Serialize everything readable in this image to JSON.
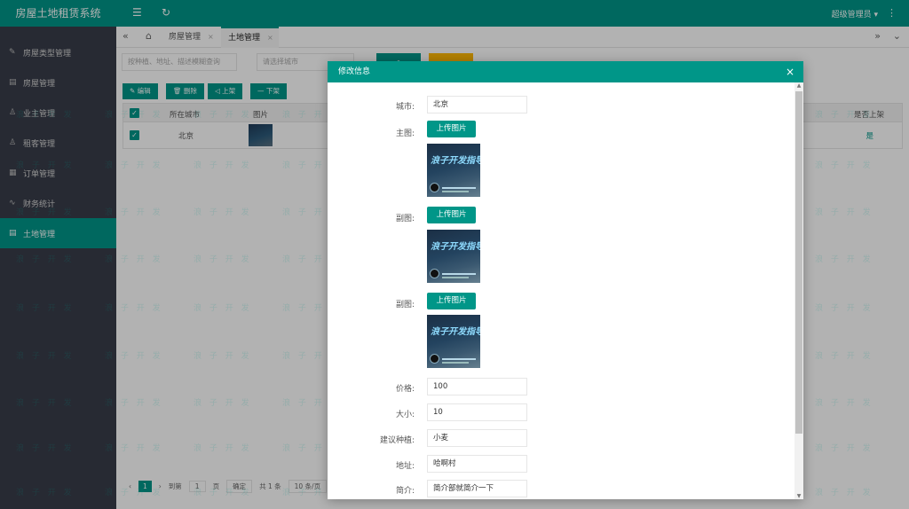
{
  "app": {
    "title": "房屋土地租赁系统"
  },
  "sidebar": {
    "items": [
      {
        "label": "房屋类型管理",
        "icon": "✎"
      },
      {
        "label": "房屋管理",
        "icon": "▤"
      },
      {
        "label": "业主管理",
        "icon": "♙"
      },
      {
        "label": "租客管理",
        "icon": "♙"
      },
      {
        "label": "订单管理",
        "icon": "▦"
      },
      {
        "label": "财务统计",
        "icon": "∿"
      },
      {
        "label": "土地管理",
        "icon": "▤"
      }
    ],
    "active": "土地管理"
  },
  "header": {
    "menu_icon": "☰",
    "refresh_icon": "↻",
    "user": "超级管理员 ▾",
    "more_icon": "⋮"
  },
  "tabs": {
    "prev_icon": "«",
    "home_icon": "⌂",
    "next_icon": "»",
    "dropdown_icon": "⌄",
    "items": [
      {
        "label": "房屋管理",
        "close": "×"
      },
      {
        "label": "土地管理",
        "close": "×"
      }
    ]
  },
  "background": {
    "search_placeholder": "按种植、地址、描述模糊查询",
    "city_placeholder": "请选择城市",
    "toolbar": {
      "edit": "✎ 编辑",
      "delete": "🗑 删除",
      "up": "◁ 上架",
      "down": "— 下架"
    },
    "columns": {
      "check": "✓",
      "city": "所在城市",
      "image": "图片",
      "listed": "是否上架"
    },
    "row": {
      "city": "北京",
      "listed": "是"
    },
    "pager": {
      "prev": "‹",
      "page": "1",
      "next": "›",
      "goto": "到第",
      "page_input": "1",
      "page_unit": "页",
      "confirm": "确定",
      "total": "共 1 条",
      "size": "10 条/页"
    }
  },
  "modal": {
    "title": "修改信息",
    "close_icon": "×",
    "fields": {
      "city_label": "城市:",
      "city_value": "北京",
      "main_label": "主图:",
      "sub1_label": "副图:",
      "sub2_label": "副图:",
      "upload_label": "上传图片",
      "price_label": "价格:",
      "price_value": "100",
      "size_label": "大小:",
      "size_value": "10",
      "crop_label": "建议种植:",
      "crop_value": "小麦",
      "addr_label": "地址:",
      "addr_value": "哈啊村",
      "intro_label": "简介:",
      "intro_value": "简介部就简介一下"
    },
    "preview_text": "浪子开发指导"
  },
  "watermark": "浪 子 开 发"
}
